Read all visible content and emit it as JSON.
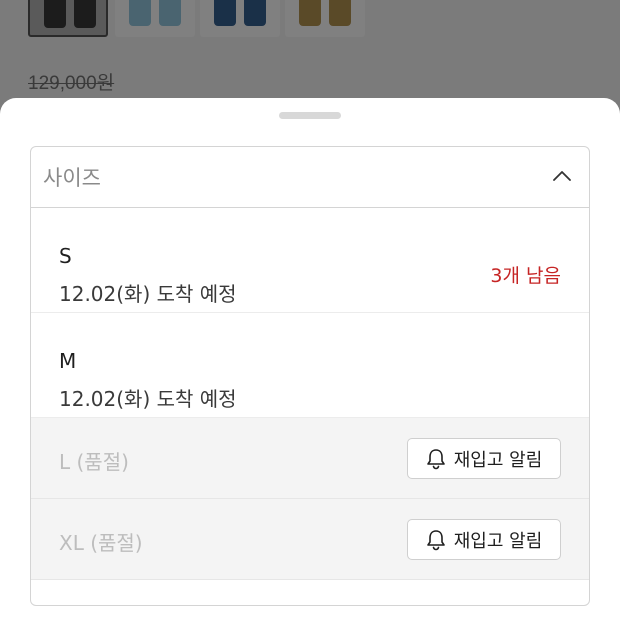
{
  "background": {
    "thumbnails": [
      {
        "name": "black",
        "color": "#1c1c1c",
        "selected": true
      },
      {
        "name": "light-blue",
        "color": "#4a6470",
        "selected": false
      },
      {
        "name": "navy",
        "color": "#1a3048",
        "selected": false
      },
      {
        "name": "olive",
        "color": "#5a4a28",
        "selected": false
      }
    ],
    "original_price": "129,000원"
  },
  "sheet": {
    "select": {
      "placeholder": "사이즈",
      "chevron_icon": "chevron-up-icon"
    },
    "options": [
      {
        "size": "S",
        "eta": "12.02(화) 도착 예정",
        "stock": "3개 남음",
        "sold_out": false
      },
      {
        "size": "M",
        "eta": "12.02(화) 도착 예정",
        "stock": "",
        "sold_out": false
      },
      {
        "size": "L (품절)",
        "restock_label": "재입고 알림",
        "sold_out": true
      },
      {
        "size": "XL (품절)",
        "restock_label": "재입고 알림",
        "sold_out": true
      }
    ]
  },
  "colors": {
    "stock_warning": "#c62424",
    "dim_overlay": "#7b7b7b"
  }
}
